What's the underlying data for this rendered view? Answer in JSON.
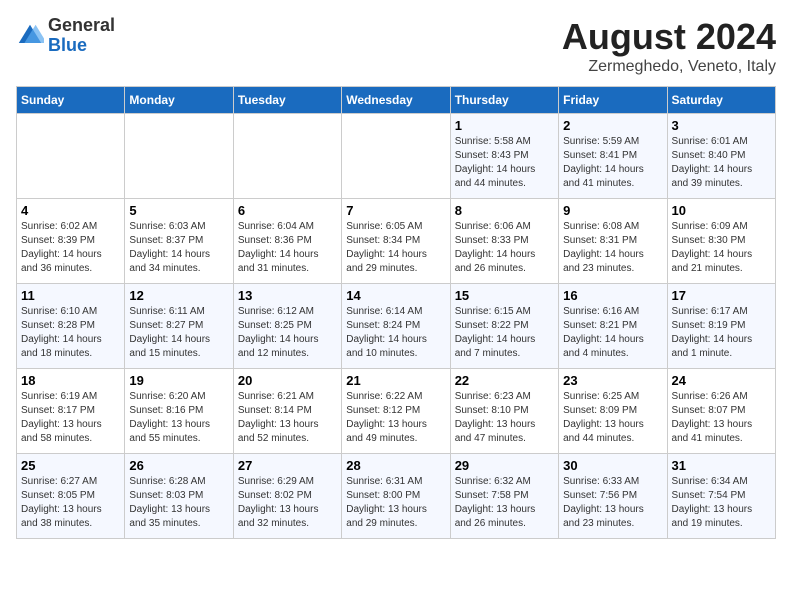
{
  "header": {
    "logo": {
      "general": "General",
      "blue": "Blue"
    },
    "title": "August 2024",
    "subtitle": "Zermeghedo, Veneto, Italy"
  },
  "days_of_week": [
    "Sunday",
    "Monday",
    "Tuesday",
    "Wednesday",
    "Thursday",
    "Friday",
    "Saturday"
  ],
  "weeks": [
    [
      {
        "num": "",
        "info": ""
      },
      {
        "num": "",
        "info": ""
      },
      {
        "num": "",
        "info": ""
      },
      {
        "num": "",
        "info": ""
      },
      {
        "num": "1",
        "info": "Sunrise: 5:58 AM\nSunset: 8:43 PM\nDaylight: 14 hours\nand 44 minutes."
      },
      {
        "num": "2",
        "info": "Sunrise: 5:59 AM\nSunset: 8:41 PM\nDaylight: 14 hours\nand 41 minutes."
      },
      {
        "num": "3",
        "info": "Sunrise: 6:01 AM\nSunset: 8:40 PM\nDaylight: 14 hours\nand 39 minutes."
      }
    ],
    [
      {
        "num": "4",
        "info": "Sunrise: 6:02 AM\nSunset: 8:39 PM\nDaylight: 14 hours\nand 36 minutes."
      },
      {
        "num": "5",
        "info": "Sunrise: 6:03 AM\nSunset: 8:37 PM\nDaylight: 14 hours\nand 34 minutes."
      },
      {
        "num": "6",
        "info": "Sunrise: 6:04 AM\nSunset: 8:36 PM\nDaylight: 14 hours\nand 31 minutes."
      },
      {
        "num": "7",
        "info": "Sunrise: 6:05 AM\nSunset: 8:34 PM\nDaylight: 14 hours\nand 29 minutes."
      },
      {
        "num": "8",
        "info": "Sunrise: 6:06 AM\nSunset: 8:33 PM\nDaylight: 14 hours\nand 26 minutes."
      },
      {
        "num": "9",
        "info": "Sunrise: 6:08 AM\nSunset: 8:31 PM\nDaylight: 14 hours\nand 23 minutes."
      },
      {
        "num": "10",
        "info": "Sunrise: 6:09 AM\nSunset: 8:30 PM\nDaylight: 14 hours\nand 21 minutes."
      }
    ],
    [
      {
        "num": "11",
        "info": "Sunrise: 6:10 AM\nSunset: 8:28 PM\nDaylight: 14 hours\nand 18 minutes."
      },
      {
        "num": "12",
        "info": "Sunrise: 6:11 AM\nSunset: 8:27 PM\nDaylight: 14 hours\nand 15 minutes."
      },
      {
        "num": "13",
        "info": "Sunrise: 6:12 AM\nSunset: 8:25 PM\nDaylight: 14 hours\nand 12 minutes."
      },
      {
        "num": "14",
        "info": "Sunrise: 6:14 AM\nSunset: 8:24 PM\nDaylight: 14 hours\nand 10 minutes."
      },
      {
        "num": "15",
        "info": "Sunrise: 6:15 AM\nSunset: 8:22 PM\nDaylight: 14 hours\nand 7 minutes."
      },
      {
        "num": "16",
        "info": "Sunrise: 6:16 AM\nSunset: 8:21 PM\nDaylight: 14 hours\nand 4 minutes."
      },
      {
        "num": "17",
        "info": "Sunrise: 6:17 AM\nSunset: 8:19 PM\nDaylight: 14 hours\nand 1 minute."
      }
    ],
    [
      {
        "num": "18",
        "info": "Sunrise: 6:19 AM\nSunset: 8:17 PM\nDaylight: 13 hours\nand 58 minutes."
      },
      {
        "num": "19",
        "info": "Sunrise: 6:20 AM\nSunset: 8:16 PM\nDaylight: 13 hours\nand 55 minutes."
      },
      {
        "num": "20",
        "info": "Sunrise: 6:21 AM\nSunset: 8:14 PM\nDaylight: 13 hours\nand 52 minutes."
      },
      {
        "num": "21",
        "info": "Sunrise: 6:22 AM\nSunset: 8:12 PM\nDaylight: 13 hours\nand 49 minutes."
      },
      {
        "num": "22",
        "info": "Sunrise: 6:23 AM\nSunset: 8:10 PM\nDaylight: 13 hours\nand 47 minutes."
      },
      {
        "num": "23",
        "info": "Sunrise: 6:25 AM\nSunset: 8:09 PM\nDaylight: 13 hours\nand 44 minutes."
      },
      {
        "num": "24",
        "info": "Sunrise: 6:26 AM\nSunset: 8:07 PM\nDaylight: 13 hours\nand 41 minutes."
      }
    ],
    [
      {
        "num": "25",
        "info": "Sunrise: 6:27 AM\nSunset: 8:05 PM\nDaylight: 13 hours\nand 38 minutes."
      },
      {
        "num": "26",
        "info": "Sunrise: 6:28 AM\nSunset: 8:03 PM\nDaylight: 13 hours\nand 35 minutes."
      },
      {
        "num": "27",
        "info": "Sunrise: 6:29 AM\nSunset: 8:02 PM\nDaylight: 13 hours\nand 32 minutes."
      },
      {
        "num": "28",
        "info": "Sunrise: 6:31 AM\nSunset: 8:00 PM\nDaylight: 13 hours\nand 29 minutes."
      },
      {
        "num": "29",
        "info": "Sunrise: 6:32 AM\nSunset: 7:58 PM\nDaylight: 13 hours\nand 26 minutes."
      },
      {
        "num": "30",
        "info": "Sunrise: 6:33 AM\nSunset: 7:56 PM\nDaylight: 13 hours\nand 23 minutes."
      },
      {
        "num": "31",
        "info": "Sunrise: 6:34 AM\nSunset: 7:54 PM\nDaylight: 13 hours\nand 19 minutes."
      }
    ]
  ]
}
